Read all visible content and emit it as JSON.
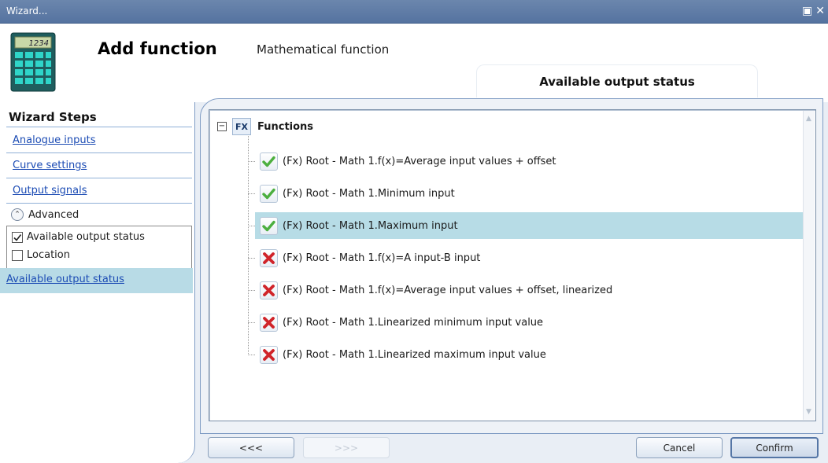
{
  "window": {
    "title": "Wizard..."
  },
  "header": {
    "title": "Add function",
    "subtitle": "Mathematical function",
    "calc_display": "1234"
  },
  "status_tab": {
    "label": "Available output status"
  },
  "sidebar": {
    "title": "Wizard Steps",
    "links": [
      "Analogue inputs",
      "Curve settings",
      "Output signals"
    ],
    "advanced_label": "Advanced",
    "options": [
      {
        "label": "Available output status",
        "checked": true
      },
      {
        "label": "Location",
        "checked": false
      }
    ],
    "active_step": "Available output status"
  },
  "tree": {
    "root_badge": "FX",
    "root_label": "Functions",
    "items": [
      {
        "label": "(Fx) Root - Math 1.f(x)=Average input values + offset",
        "status": "ok"
      },
      {
        "label": "(Fx) Root - Math 1.Minimum input",
        "status": "ok"
      },
      {
        "label": "(Fx) Root - Math 1.Maximum input",
        "status": "ok"
      },
      {
        "label": "(Fx) Root - Math 1.f(x)=A input-B input",
        "status": "error"
      },
      {
        "label": "(Fx) Root - Math 1.f(x)=Average input values + offset, linearized",
        "status": "error"
      },
      {
        "label": "(Fx) Root - Math 1.Linearized minimum input value",
        "status": "error"
      },
      {
        "label": "(Fx) Root - Math 1.Linearized maximum input value",
        "status": "error"
      }
    ],
    "selected_index": 2
  },
  "buttons": {
    "back": "<<<",
    "next": ">>>",
    "cancel": "Cancel",
    "confirm": "Confirm"
  },
  "colors": {
    "ok": "#4caf3f",
    "error": "#d0242a",
    "selection": "#b7dce6"
  }
}
